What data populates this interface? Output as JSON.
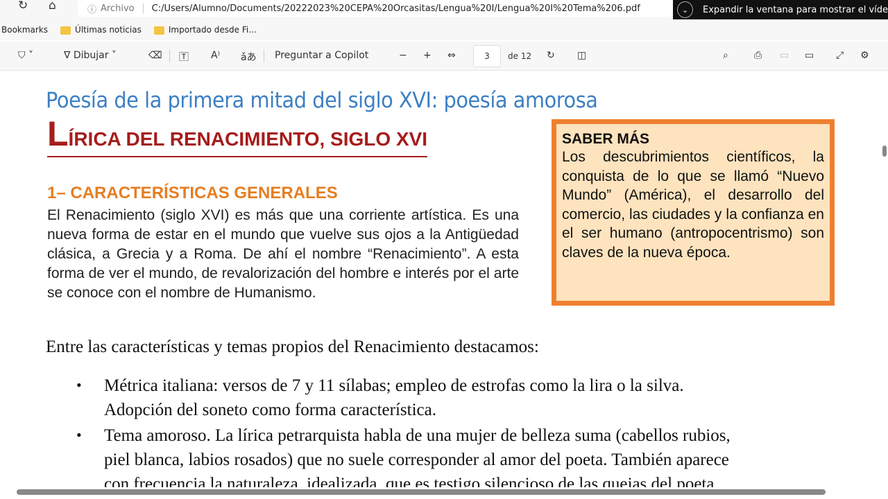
{
  "browser": {
    "address_label": "Archivo",
    "url": "C:/Users/Alumno/Documents/20222023%20CEPA%20Orcasitas/Lengua%20I/Lengua%20I%20Tema%206.pdf",
    "pip_text": "Expandir la ventana para mostrar el víde"
  },
  "bookmarks": [
    "Bookmarks",
    "Últimas noticias",
    "Importado desde Fi..."
  ],
  "toolbar": {
    "draw": "Dibujar",
    "copilot": "Preguntar a Copilot",
    "page": "3",
    "of": "de 12"
  },
  "doc": {
    "title": "Poesía de la primera mitad del siglo XVI: poesía amorosa",
    "h2_first": "L",
    "h2_rest": "ÍRICA DEL RENACIMIENTO, SIGLO XVI",
    "h3": "1– CARACTERÍSTICAS GENERALES",
    "p1": "El Renacimiento (siglo XVI) es más que una corriente artística. Es una nueva forma de estar en el mundo que vuelve sus ojos a la Antigüedad clásica, a Grecia y a Roma. De ahí el nombre “Renacimiento”. A esta forma de ver el mundo, de revalorización del hombre e interés por el arte se conoce con el nombre de Humanismo.",
    "box_title": "SABER MÁS",
    "box_body": "Los descubrimientos científicos, la conquista de lo que se llamó “Nuevo Mundo” (América), el desarrollo del comercio, las ciudades y la confianza en el ser humano (antropocentrismo) son claves de la nueva época.",
    "intro": "Entre las características y temas propios del Renacimiento destacamos:",
    "bullets": [
      {
        "l1": "Métrica italiana: versos de 7 y 11 sílabas; empleo de estrofas como la lira o la silva.",
        "l2": "Adopción del soneto como forma característica."
      },
      {
        "l1": "Tema amoroso. La lírica petrarquista habla de una mujer de belleza suma (cabellos rubios,",
        "l2": "piel blanca, labios rosados) que no suele corresponder al amor del poeta. También aparece",
        "l3": "con frecuencia la naturaleza, idealizada, que es testigo silencioso de las quejas del poeta."
      }
    ]
  }
}
